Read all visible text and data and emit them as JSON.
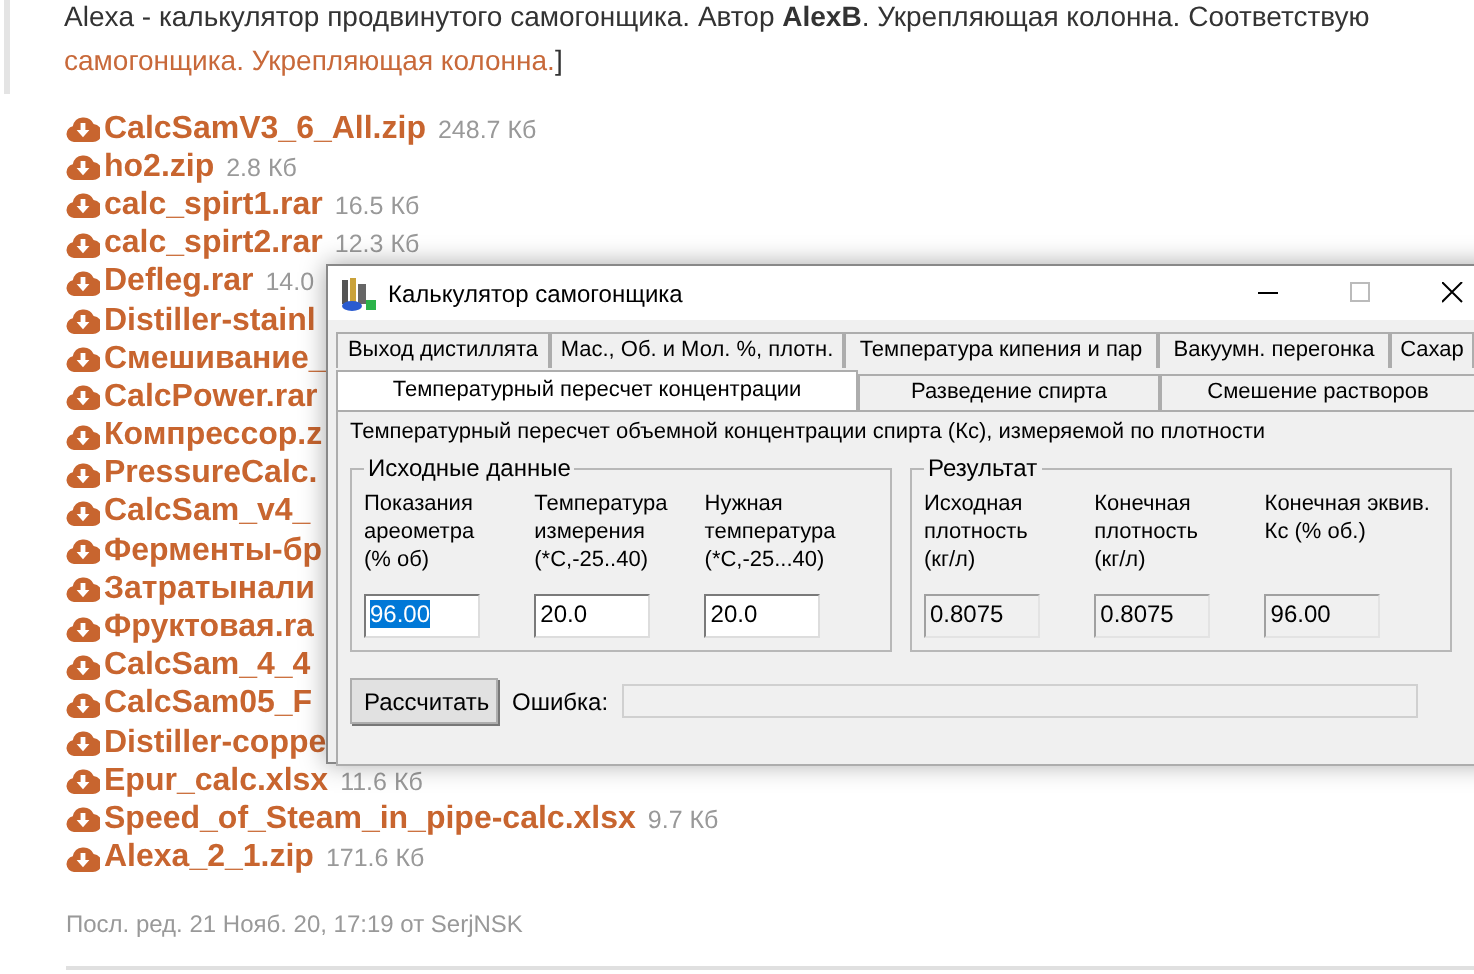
{
  "post": {
    "intro": "Alexa - калькулятор продвинутого самогонщика. Автор **AlexB**. Укрепляющая колонна. Соответствую",
    "link": "самогонщика. Укрепляющая колонна.",
    "after_link": "]",
    "files": [
      {
        "name": "CalcSamV3_6_All.zip",
        "size": "248.7 Кб"
      },
      {
        "name": "ho2.zip",
        "size": "2.8 Кб"
      },
      {
        "name": "calc_spirt1.rar",
        "size": "16.5 Кб"
      },
      {
        "name": "calc_spirt2.rar",
        "size": "12.3 Кб"
      },
      {
        "name": "Defleg.rar",
        "size": "14.0"
      },
      {
        "name": "Distiller-stainl"
      },
      {
        "name": "Смешивание_"
      },
      {
        "name": "CalcPower.rar"
      },
      {
        "name": "Компрессор.z"
      },
      {
        "name": "PressureCalc."
      },
      {
        "name": "CalcSam_v4_"
      },
      {
        "name": "Ферменты-бр"
      },
      {
        "name": "Затратынали"
      },
      {
        "name": "Фруктовая.ra"
      },
      {
        "name": "CalcSam_4_4"
      },
      {
        "name": "CalcSam05_F"
      },
      {
        "name": "Distiller-coppe"
      },
      {
        "name": "Epur_calc.xlsx",
        "size": "11.6 Кб"
      },
      {
        "name": "Speed_of_Steam_in_pipe-calc.xlsx",
        "size": "9.7 Кб"
      },
      {
        "name": "Alexa_2_1.zip",
        "size": "171.6 Кб"
      }
    ],
    "footer": "Посл. ред. 21 Нояб. 20, 17:19 от SerjNSK"
  },
  "window": {
    "title": "Калькулятор самогонщика",
    "tabs_row1": [
      {
        "label": "Выход дистиллята",
        "selected": false
      },
      {
        "label": "Мас., Об. и Мол. %, плотн.",
        "selected": false
      },
      {
        "label": "Температура кипения и пар",
        "selected": false
      },
      {
        "label": "Вакуумн. перегонка",
        "selected": false
      },
      {
        "label": "Сахар",
        "selected": false
      }
    ],
    "tabs_row2": [
      {
        "label": "Температурный пересчет концентрации",
        "selected": true
      },
      {
        "label": "Разведение спирта",
        "selected": false
      },
      {
        "label": "Смешение растворов",
        "selected": false
      }
    ],
    "description": "Температурный пересчет объемной концентрации спирта (Кс), измеряемой по плотности",
    "input_group": {
      "title": "Исходные данные",
      "fields": [
        {
          "label": "Показания\nареометра\n(% об)",
          "value": "96.00",
          "readonly": false,
          "text_selected": true
        },
        {
          "label": "Температура\nизмерения\n(*С,-25..40)",
          "value": "20.0",
          "readonly": false,
          "text_selected": false
        },
        {
          "label": "Нужная\nтемпература\n(*С,-25...40)",
          "value": "20.0",
          "readonly": false,
          "text_selected": false
        }
      ]
    },
    "result_group": {
      "title": "Результат",
      "fields": [
        {
          "label": "Исходная\nплотность\n(кг/л)",
          "value": "0.8075",
          "readonly": true,
          "text_selected": false
        },
        {
          "label": "Конечная\nплотность\n(кг/л)",
          "value": "0.8075",
          "readonly": true,
          "text_selected": false
        },
        {
          "label": "Конечная эквив.\nКс (% об.)",
          "value": "96.00",
          "readonly": true,
          "text_selected": false
        }
      ]
    },
    "calculate_button": "Рассчитать",
    "error_label": "Ошибка:"
  }
}
